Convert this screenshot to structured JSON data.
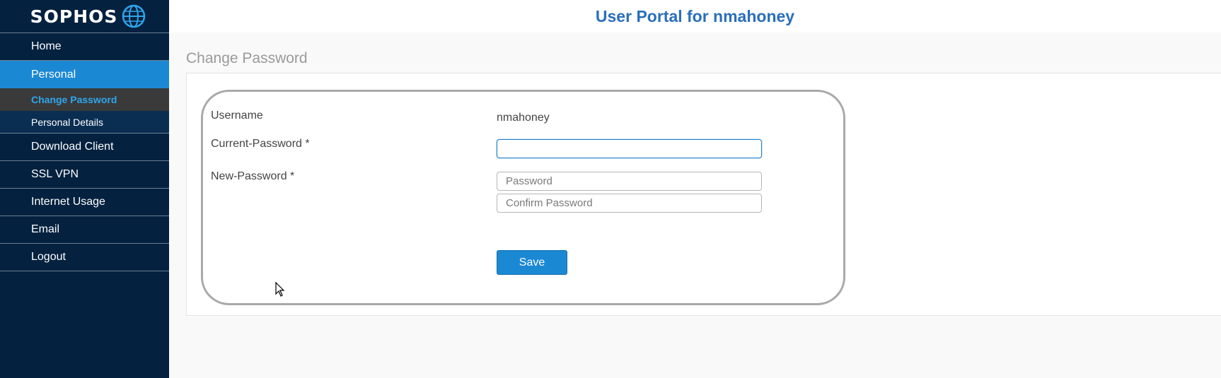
{
  "brand": {
    "name": "SOPHOS",
    "logo_icon": "globe-icon"
  },
  "header": {
    "title": "User Portal for nmahoney"
  },
  "sidebar": {
    "items": [
      {
        "label": "Home"
      },
      {
        "label": "Personal"
      },
      {
        "label": "Change Password"
      },
      {
        "label": "Personal Details"
      },
      {
        "label": "Download Client"
      },
      {
        "label": "SSL VPN"
      },
      {
        "label": "Internet Usage"
      },
      {
        "label": "Email"
      },
      {
        "label": "Logout"
      }
    ]
  },
  "page": {
    "title": "Change Password"
  },
  "form": {
    "username_label": "Username",
    "username_value": "nmahoney",
    "current_password_label": "Current-Password *",
    "current_password_value": "",
    "new_password_label": "New-Password *",
    "password_placeholder": "Password",
    "confirm_placeholder": "Confirm Password",
    "save_label": "Save"
  },
  "colors": {
    "sidebar_bg": "#04213f",
    "accent": "#1b88d4",
    "title": "#2a6ebb"
  }
}
